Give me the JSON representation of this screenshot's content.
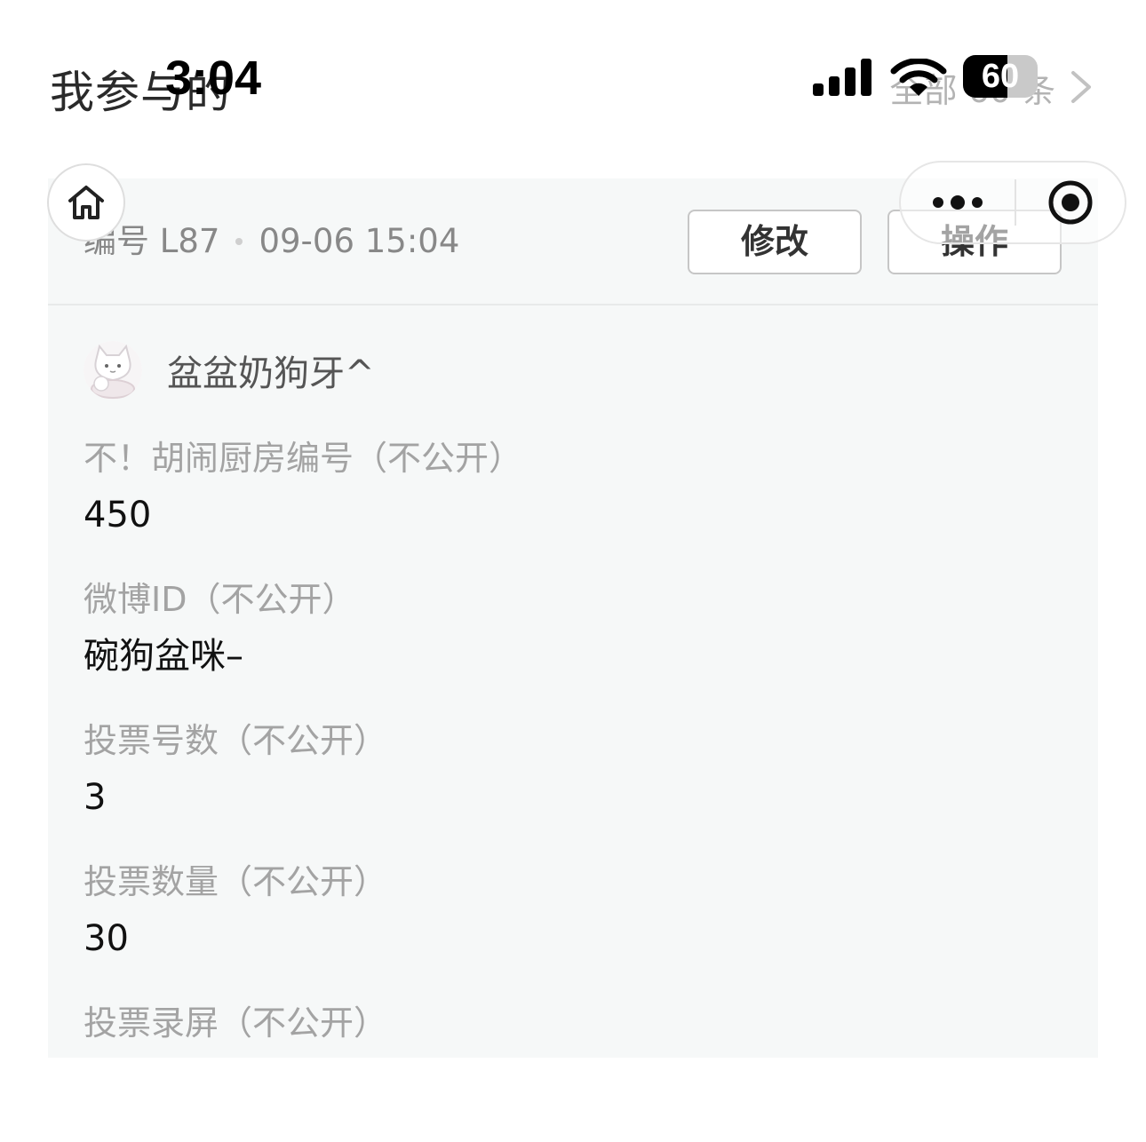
{
  "header": {
    "title": "我参与的",
    "view_all_label": "全部 60 条"
  },
  "status_bar": {
    "time": "3:04",
    "battery_percent": 60,
    "battery_label": "60",
    "icons": [
      "cellular-signal-icon",
      "wifi-icon",
      "battery-icon"
    ]
  },
  "mini_program": {
    "icons": [
      "home-icon",
      "more-dots-icon",
      "close-target-icon"
    ]
  },
  "record": {
    "number": "编号 L87",
    "datetime": "09-06 15:04",
    "edit_label": "修改",
    "ops_label": "操作",
    "author": "盆盆奶狗牙^",
    "fields": [
      {
        "label": "不！胡闹厨房编号（不公开）",
        "value": "450"
      },
      {
        "label": "微博ID（不公开）",
        "value": "碗狗盆咪–"
      },
      {
        "label": "投票号数（不公开）",
        "value": "3"
      },
      {
        "label": "投票数量（不公开）",
        "value": "30"
      },
      {
        "label": "投票录屏（不公开）",
        "value": ""
      }
    ]
  }
}
